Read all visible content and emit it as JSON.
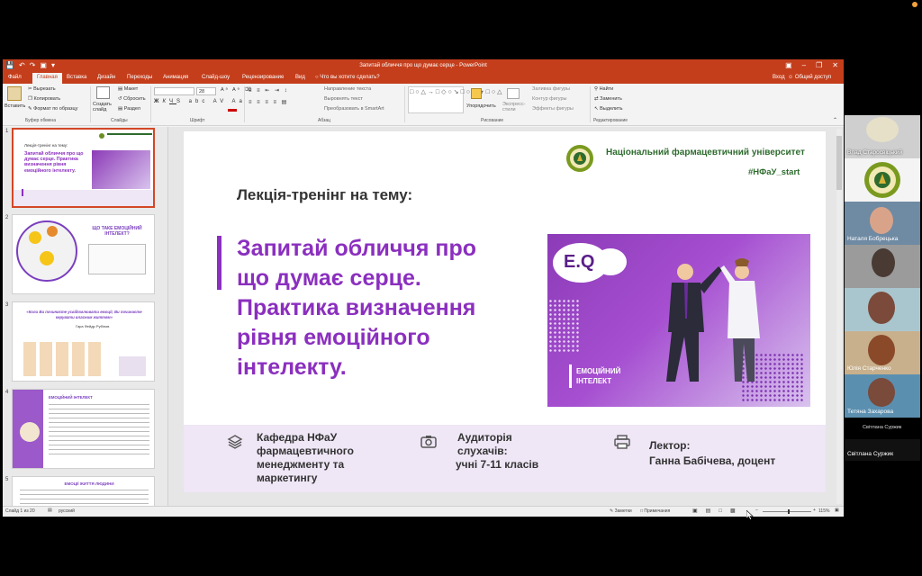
{
  "window": {
    "title": "Запитай обличчя про що думає серце - PowerPoint",
    "quick_access_icons": [
      "save-icon",
      "undo-icon",
      "redo-icon",
      "start-presentation-icon",
      "customize-icon"
    ],
    "controls": [
      "ribbon-display-icon",
      "minimize-icon",
      "restore-icon",
      "close-icon"
    ]
  },
  "ribbon_tabs": [
    "Файл",
    "Главная",
    "Вставка",
    "Дизайн",
    "Переходы",
    "Анимация",
    "Слайд-шоу",
    "Рецензирование",
    "Вид"
  ],
  "active_tab": "Главная",
  "tell_me": "Что вы хотите сделать?",
  "sign_in": "Вход",
  "share": "Общий доступ",
  "ribbon": {
    "paste": "Вставить",
    "cut": "Вырезать",
    "copy": "Копировать",
    "format_painter": "Формат по образцу",
    "clipboard": "Буфер обмена",
    "new_slide": "Создать слайд",
    "layout": "Макет",
    "reset": "Сбросить",
    "section": "Раздел",
    "slides": "Слайды",
    "font_size": "28",
    "font": "Шрифт",
    "text_direction": "Направление текста",
    "align_text": "Выровнять текст",
    "smartart": "Преобразовать в SmartArt",
    "paragraph": "Абзац",
    "arrange": "Упорядочить",
    "quick_styles": "Экспресс-стили",
    "shape_fill": "Заливка фигуры",
    "shape_outline": "Контур фигуры",
    "shape_effects": "Эффекты фигуры",
    "drawing": "Рисование",
    "find": "Найти",
    "replace": "Заменить",
    "select": "Выделить",
    "editing": "Редактирование"
  },
  "thumbnails": [
    {
      "num": "1",
      "title": "Запитай обличчя про що думає серце. Практика визначення рівня емоційного інтелекту.",
      "sub": "Лекція-тренінг на тему:"
    },
    {
      "num": "2",
      "title": "ЩО ТАКЕ ЕМОЦІЙНИЙ ІНТЕЛЕКТ?"
    },
    {
      "num": "3",
      "quote": "«Коли Ви починаєте усвідомлювати емоції, Ви починаєте керувати власним життям»",
      "author": "Гара Фейдр Рубінов"
    },
    {
      "num": "4",
      "title": "ЕМОЦІЙНИЙ ІНТЕЛЕКТ"
    },
    {
      "num": "5",
      "title": "ЕМОЦІЇ ЖИТТЯ ЛЮДИНИ"
    }
  ],
  "slide": {
    "university": "Національний фармацевтичний університет",
    "hashtag": "#НФаУ_start",
    "subtitle": "Лекція-тренінг на тему:",
    "title_lines": [
      "Запитай обличчя про",
      "що думає серце.",
      "Практика визначення",
      "рівня емоційного",
      "інтелекту."
    ],
    "eq_badge": "E.Q",
    "eq_caption_1": "ЕМОЦІЙНИЙ",
    "eq_caption_2": "ІНТЕЛЕКТ",
    "dept_lines": [
      "Кафедра НФаУ",
      "фармацевтичного",
      "менеджменту та",
      "маркетингу"
    ],
    "audience_lines": [
      "Аудиторія",
      "слухачів:",
      "учні 7-11 класів"
    ],
    "lecturer_lines": [
      "Лектор:",
      "Ганна Бабічева, доцент"
    ]
  },
  "status": {
    "slide_of": "Слайд 1 из 20",
    "language": "русский",
    "notes": "Заметки",
    "comments": "Примечания",
    "zoom": "115%",
    "zoom_level": 115
  },
  "participants": [
    {
      "name": "Влад Старосвіцький"
    },
    {
      "name": "Наталя Бобрецька"
    },
    {
      "name": ""
    },
    {
      "name": ""
    },
    {
      "name": "Юлія Старченко"
    },
    {
      "name": "Тетяна Захарова"
    },
    {
      "name": "Світлана Суржик"
    },
    {
      "name": "Світлана Суржик"
    }
  ]
}
